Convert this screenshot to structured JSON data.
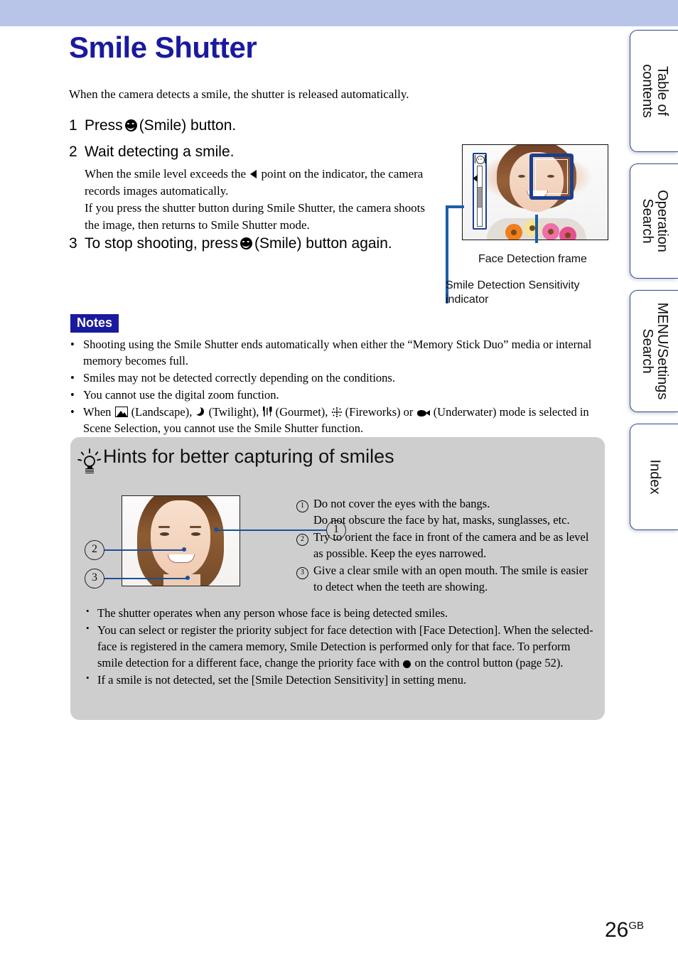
{
  "document": {
    "title": "Smile Shutter",
    "intro": "When the camera detects a smile, the shutter is released automatically.",
    "page_number": "26",
    "page_suffix": "GB"
  },
  "sidebar": {
    "tabs": [
      {
        "label": "Table of\ncontents",
        "name": "table-of-contents"
      },
      {
        "label": "Operation\nSearch",
        "name": "operation-search"
      },
      {
        "label": "MENU/Settings\nSearch",
        "name": "menu-settings-search"
      },
      {
        "label": "Index",
        "name": "index"
      }
    ]
  },
  "steps": [
    {
      "num": "1",
      "text_before": "Press",
      "icon": "smile-icon",
      "text_after": "(Smile) button."
    },
    {
      "num": "2",
      "text_before": "Wait detecting a smile.",
      "icon": "",
      "text_after": ""
    },
    {
      "num": "3",
      "text_before": "To stop shooting, press",
      "icon": "smile-icon",
      "text_after": "(Smile) button again."
    }
  ],
  "step2_body": {
    "line1_a": "When the smile level exceeds the",
    "line1_b": "point on the indicator, the camera records images automatically.",
    "line2": "If you press the shutter button during Smile Shutter, the camera shoots the image, then returns to Smile Shutter mode."
  },
  "figure": {
    "caption_face": "Face Detection frame",
    "caption_sensitivity": "Smile Detection Sensitivity indicator"
  },
  "notes": {
    "heading": "Notes",
    "items": [
      {
        "text": "Shooting using the Smile Shutter ends automatically when either the “Memory Stick Duo” media or internal memory becomes full."
      },
      {
        "text": "Smiles may not be detected correctly depending on the conditions."
      },
      {
        "text": "You cannot use the digital zoom function."
      }
    ],
    "scene_note": {
      "a": "When",
      "landscape": "(Landscape),",
      "twilight": "(Twilight),",
      "gourmet": "(Gourmet),",
      "fireworks": "(Fireworks) or",
      "underwater": "(Underwater) mode is selected in Scene Selection, you cannot use the Smile Shutter function."
    }
  },
  "hints": {
    "title": "Hints for better capturing of smiles",
    "callouts": [
      "1",
      "2",
      "3"
    ],
    "numbered": [
      {
        "mark": "1",
        "lines": [
          "Do not cover the eyes with the bangs.",
          "Do not obscure the face by hat, masks, sunglasses, etc."
        ]
      },
      {
        "mark": "2",
        "lines": [
          "Try to orient the face in front of the camera and be as level as possible. Keep the eyes narrowed."
        ]
      },
      {
        "mark": "3",
        "lines": [
          "Give a clear smile with an open mouth. The smile is easier to detect when the teeth are showing."
        ]
      }
    ],
    "bullets": [
      {
        "text": "The shutter operates when any person whose face is being detected smiles."
      },
      {
        "text_a": "You can select or register the priority subject for face detection with [Face Detection]. When the selected-face is registered in the camera memory, Smile Detection is performed only for that face. To perform smile detection for a different face, change the priority face with",
        "text_b": "on the control button (page 52)."
      },
      {
        "text": "If a smile is not detected, set the [Smile Detection Sensitivity] in setting menu."
      }
    ]
  },
  "colors": {
    "title_blue": "#1a1a9e",
    "header_band": "#b9c5e8",
    "notes_badge_bg": "#1a1a9e",
    "hints_bg": "#cecece",
    "tab_border": "#2d4a8a",
    "callout_blue": "#1b4f99"
  }
}
